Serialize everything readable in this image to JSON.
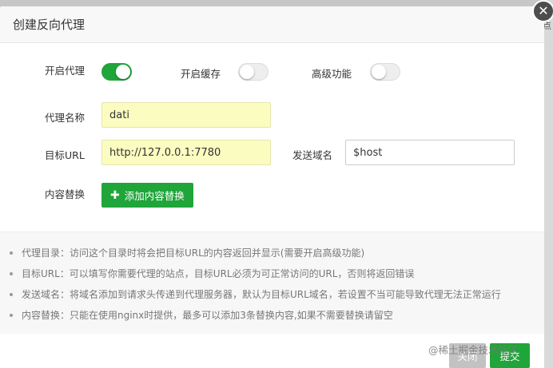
{
  "dialog": {
    "title": "创建反向代理",
    "close_icon": "close-icon"
  },
  "form": {
    "proxy_enable": {
      "label": "开启代理",
      "on": true
    },
    "cache_enable": {
      "label": "开启缓存",
      "on": false
    },
    "advanced": {
      "label": "高级功能",
      "on": false
    },
    "proxy_name": {
      "label": "代理名称",
      "value": "dati"
    },
    "target_url": {
      "label": "目标URL",
      "value": "http://127.0.0.1:7780"
    },
    "send_domain": {
      "label": "发送域名",
      "value": "$host"
    },
    "content_replace": {
      "label": "内容替换",
      "button_label": "添加内容替换",
      "button_icon": "plus-icon"
    }
  },
  "tips": [
    "代理目录：访问这个目录时将会把目标URL的内容返回并显示(需要开启高级功能)",
    "目标URL：可以填写你需要代理的站点，目标URL必须为可正常访问的URL，否则将返回错误",
    "发送域名：将域名添加到请求头传递到代理服务器，默认为目标URL域名，若设置不当可能导致代理无法正常运行",
    "内容替换：只能在使用nginx时提供，最多可以添加3条替换内容,如果不需要替换请留空"
  ],
  "footer": {
    "cancel_label": "关闭",
    "submit_label": "提交",
    "watermark": "@稀土掘金技术社区"
  },
  "background": {
    "edge_char": "点"
  },
  "colors": {
    "accent_green": "#20a53a",
    "highlight_yellow": "#fbfcc0",
    "backdrop": "#9b9b9b"
  }
}
